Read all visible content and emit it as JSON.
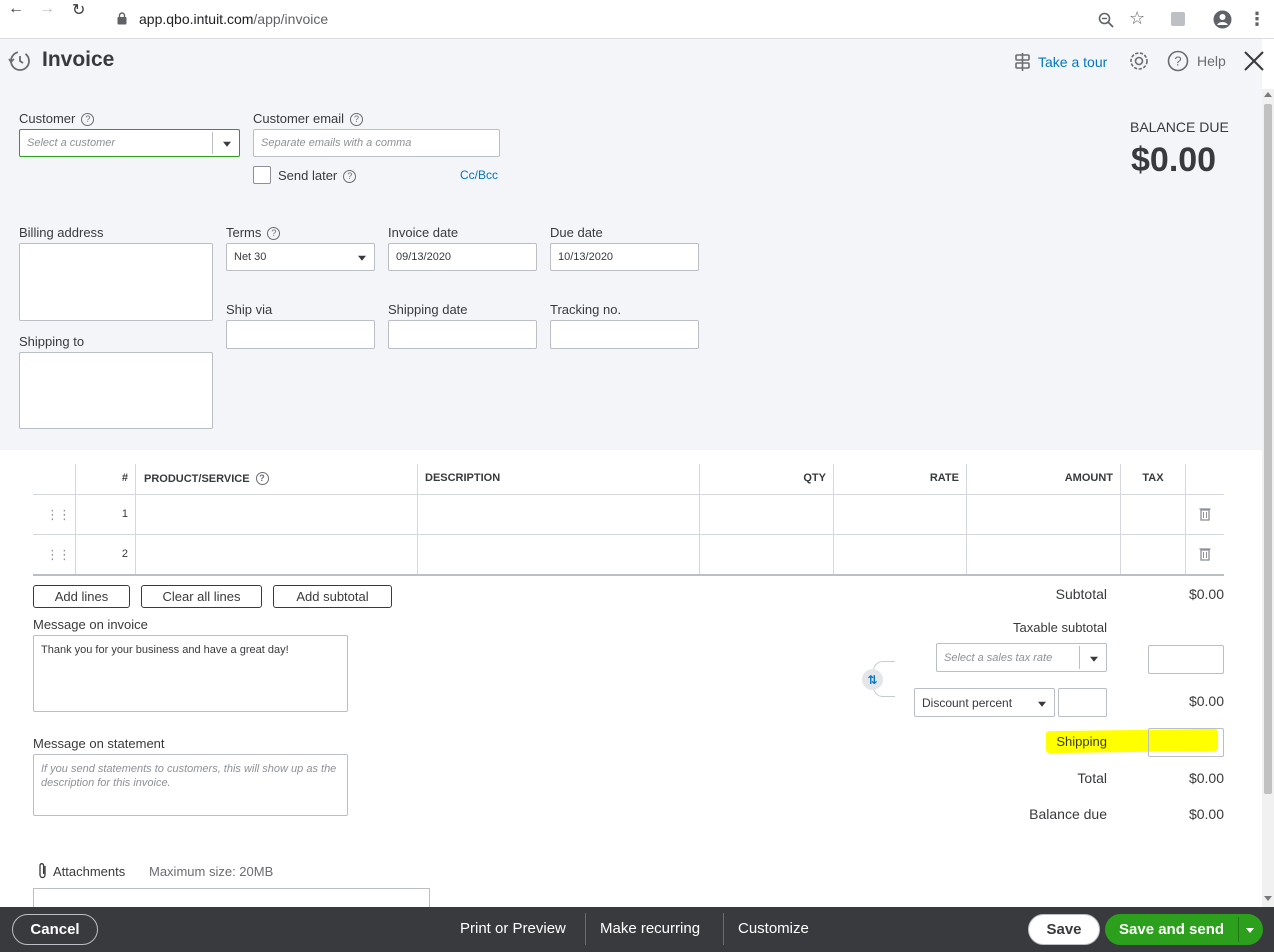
{
  "browser": {
    "url_host": "app.qbo.intuit.com",
    "url_path": "/app/invoice"
  },
  "header": {
    "title": "Invoice",
    "tour_label": "Take a tour",
    "help_label": "Help"
  },
  "customer": {
    "label": "Customer",
    "placeholder": "Select a customer"
  },
  "email": {
    "label": "Customer email",
    "placeholder": "Separate emails with a comma",
    "send_later_label": "Send later",
    "cc_bcc_label": "Cc/Bcc"
  },
  "balance": {
    "label": "BALANCE DUE",
    "amount": "$0.00"
  },
  "billing": {
    "label": "Billing address"
  },
  "terms": {
    "label": "Terms",
    "value": "Net 30"
  },
  "invoice_date": {
    "label": "Invoice date",
    "value": "09/13/2020"
  },
  "due_date": {
    "label": "Due date",
    "value": "10/13/2020"
  },
  "ship_via": {
    "label": "Ship via"
  },
  "shipping_date": {
    "label": "Shipping date"
  },
  "tracking": {
    "label": "Tracking no."
  },
  "shipping_to": {
    "label": "Shipping to"
  },
  "table": {
    "columns": [
      "#",
      "PRODUCT/SERVICE",
      "DESCRIPTION",
      "QTY",
      "RATE",
      "AMOUNT",
      "TAX"
    ],
    "rows": [
      {
        "num": "1"
      },
      {
        "num": "2"
      }
    ]
  },
  "actions": {
    "add_lines": "Add lines",
    "clear_all_lines": "Clear all lines",
    "add_subtotal": "Add subtotal"
  },
  "message_invoice": {
    "label": "Message on invoice",
    "value": "Thank you for your business and have a great day!"
  },
  "message_statement": {
    "label": "Message on statement",
    "placeholder": "If you send statements to customers, this will show up as the description for this invoice."
  },
  "attachments": {
    "label": "Attachments",
    "max_size": "Maximum size: 20MB"
  },
  "summary": {
    "subtotal_label": "Subtotal",
    "subtotal_value": "$0.00",
    "taxable_subtotal_label": "Taxable subtotal",
    "tax_rate_placeholder": "Select a sales tax rate",
    "discount_type": "Discount percent",
    "discount_value": "$0.00",
    "shipping_label": "Shipping",
    "total_label": "Total",
    "total_value": "$0.00",
    "balance_due_label": "Balance due",
    "balance_due_value": "$0.00"
  },
  "footer": {
    "cancel": "Cancel",
    "print_preview": "Print or Preview",
    "make_recurring": "Make recurring",
    "customize": "Customize",
    "save": "Save",
    "save_and_send": "Save and send"
  },
  "colors": {
    "link": "#0077c5",
    "primary_green": "#2ca01c",
    "footer_bg": "#393a3d",
    "highlight": "#ffff00"
  }
}
